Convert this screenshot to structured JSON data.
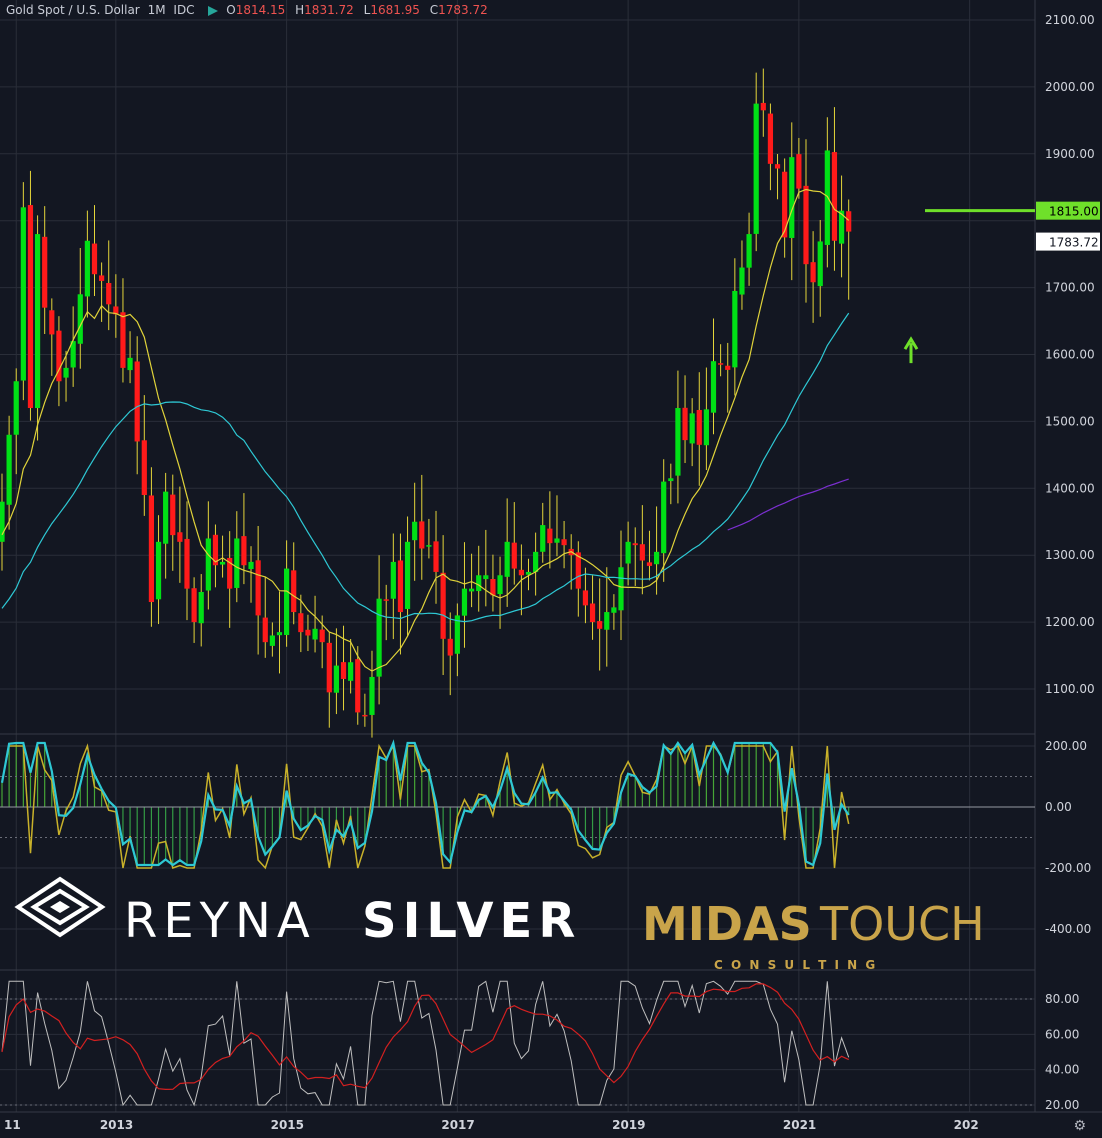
{
  "header": {
    "title": "Gold Spot / U.S. Dollar",
    "interval": "1M",
    "exchange": "IDC",
    "o_label": "O",
    "o": "1814.15",
    "h_label": "H",
    "h": "1831.72",
    "l_label": "L",
    "l": "1681.95",
    "c_label": "C",
    "c": "1783.72"
  },
  "watermark": {
    "left_brand_light": "REYNA",
    "left_brand_bold": "SILVER",
    "right_brand_bold": "MIDAS",
    "right_brand_light": "TOUCH",
    "right_sub": "C O N S U L T I N G"
  },
  "colors": {
    "background": "#131722",
    "up": "#00e016",
    "down": "#ff1a1a",
    "wick": "#e4d53a",
    "ma_short": "#e0d33a",
    "ma_mid": "#2ec8d4",
    "ma_long": "#7b2fd0",
    "marker": "#6fe02a",
    "cci_slow": "#2ec8d4",
    "cci_fast": "#c8b12a",
    "stoch_fast": "#bfbfbf",
    "stoch_slow": "#d32020",
    "gold_brand": "#c9a44a"
  },
  "chart_data": [
    {
      "type": "candlestick",
      "name": "price",
      "x_axis": {
        "unit": "month",
        "range": [
          "2011-09",
          "2022-04"
        ],
        "tick_labels": [
          "11",
          "2013",
          "2015",
          "2017",
          "2019",
          "2021",
          "202"
        ]
      },
      "y_axis": {
        "range": [
          1030,
          2130
        ],
        "ticks": [
          "1100.00",
          "1200.00",
          "1300.00",
          "1400.00",
          "1500.00",
          "1600.00",
          "1700.00",
          "1800.00",
          "1900.00",
          "2000.00",
          "2100.00"
        ]
      },
      "price_labels": {
        "level": "1815.00",
        "last": "1783.72"
      },
      "horizontal_level": 1815,
      "up_arrow_at": 1620,
      "anchors_close": [
        [
          "2011-09",
          1380
        ],
        [
          "2011-10",
          1480
        ],
        [
          "2011-11",
          1560
        ],
        [
          "2011-12",
          1820
        ],
        [
          "2012-01",
          1520
        ],
        [
          "2012-02",
          1780
        ],
        [
          "2012-03",
          1670
        ],
        [
          "2012-04",
          1630
        ],
        [
          "2012-05",
          1560
        ],
        [
          "2012-06",
          1580
        ],
        [
          "2012-07",
          1620
        ],
        [
          "2012-08",
          1690
        ],
        [
          "2012-09",
          1770
        ],
        [
          "2012-10",
          1720
        ],
        [
          "2012-11",
          1710
        ],
        [
          "2012-12",
          1675
        ],
        [
          "2013-01",
          1660
        ],
        [
          "2013-02",
          1580
        ],
        [
          "2013-03",
          1595
        ],
        [
          "2013-04",
          1470
        ],
        [
          "2013-05",
          1390
        ],
        [
          "2013-06",
          1230
        ],
        [
          "2013-07",
          1320
        ],
        [
          "2013-08",
          1395
        ],
        [
          "2013-09",
          1330
        ],
        [
          "2013-10",
          1320
        ],
        [
          "2013-11",
          1250
        ],
        [
          "2013-12",
          1200
        ],
        [
          "2014-01",
          1245
        ],
        [
          "2014-02",
          1325
        ],
        [
          "2014-03",
          1285
        ],
        [
          "2014-04",
          1290
        ],
        [
          "2014-05",
          1250
        ],
        [
          "2014-06",
          1325
        ],
        [
          "2014-07",
          1285
        ],
        [
          "2014-08",
          1290
        ],
        [
          "2014-09",
          1210
        ],
        [
          "2014-10",
          1170
        ],
        [
          "2014-11",
          1180
        ],
        [
          "2014-12",
          1185
        ],
        [
          "2015-01",
          1280
        ],
        [
          "2015-02",
          1215
        ],
        [
          "2015-03",
          1185
        ],
        [
          "2015-04",
          1180
        ],
        [
          "2015-05",
          1190
        ],
        [
          "2015-06",
          1170
        ],
        [
          "2015-07",
          1095
        ],
        [
          "2015-08",
          1135
        ],
        [
          "2015-09",
          1115
        ],
        [
          "2015-10",
          1140
        ],
        [
          "2015-11",
          1065
        ],
        [
          "2015-12",
          1060
        ],
        [
          "2016-01",
          1118
        ],
        [
          "2016-02",
          1235
        ],
        [
          "2016-03",
          1233
        ],
        [
          "2016-04",
          1290
        ],
        [
          "2016-05",
          1215
        ],
        [
          "2016-06",
          1320
        ],
        [
          "2016-07",
          1350
        ],
        [
          "2016-08",
          1310
        ],
        [
          "2016-09",
          1315
        ],
        [
          "2016-10",
          1275
        ],
        [
          "2016-11",
          1175
        ],
        [
          "2016-12",
          1150
        ],
        [
          "2017-01",
          1210
        ],
        [
          "2017-02",
          1250
        ],
        [
          "2017-03",
          1250
        ],
        [
          "2017-04",
          1270
        ],
        [
          "2017-05",
          1270
        ],
        [
          "2017-06",
          1240
        ],
        [
          "2017-07",
          1270
        ],
        [
          "2017-08",
          1320
        ],
        [
          "2017-09",
          1280
        ],
        [
          "2017-10",
          1270
        ],
        [
          "2017-11",
          1275
        ],
        [
          "2017-12",
          1305
        ],
        [
          "2018-01",
          1345
        ],
        [
          "2018-02",
          1318
        ],
        [
          "2018-03",
          1325
        ],
        [
          "2018-04",
          1315
        ],
        [
          "2018-05",
          1300
        ],
        [
          "2018-06",
          1250
        ],
        [
          "2018-07",
          1225
        ],
        [
          "2018-08",
          1200
        ],
        [
          "2018-09",
          1190
        ],
        [
          "2018-10",
          1215
        ],
        [
          "2018-11",
          1222
        ],
        [
          "2018-12",
          1282
        ],
        [
          "2019-01",
          1320
        ],
        [
          "2019-02",
          1315
        ],
        [
          "2019-03",
          1292
        ],
        [
          "2019-04",
          1284
        ],
        [
          "2019-05",
          1305
        ],
        [
          "2019-06",
          1410
        ],
        [
          "2019-07",
          1415
        ],
        [
          "2019-08",
          1520
        ],
        [
          "2019-09",
          1472
        ],
        [
          "2019-10",
          1512
        ],
        [
          "2019-11",
          1465
        ],
        [
          "2019-12",
          1518
        ],
        [
          "2020-01",
          1590
        ],
        [
          "2020-02",
          1585
        ],
        [
          "2020-03",
          1577
        ],
        [
          "2020-04",
          1695
        ],
        [
          "2020-05",
          1730
        ],
        [
          "2020-06",
          1780
        ],
        [
          "2020-07",
          1975
        ],
        [
          "2020-08",
          1965
        ],
        [
          "2020-09",
          1885
        ],
        [
          "2020-10",
          1878
        ],
        [
          "2020-11",
          1775
        ],
        [
          "2020-12",
          1895
        ],
        [
          "2021-01",
          1848
        ],
        [
          "2021-02",
          1735
        ],
        [
          "2021-03",
          1708
        ],
        [
          "2021-04",
          1769
        ],
        [
          "2021-05",
          1905
        ],
        [
          "2021-06",
          1770
        ],
        [
          "2021-07",
          1815
        ],
        [
          "2021-08",
          1784
        ]
      ]
    },
    {
      "type": "line",
      "name": "cci",
      "y_axis": {
        "range": [
          -420,
          220
        ],
        "ticks": [
          "200.00",
          "0.00",
          "-200.00",
          "-400.00"
        ],
        "bands": [
          100,
          -100
        ]
      }
    },
    {
      "type": "line",
      "name": "stochastic",
      "y_axis": {
        "range": [
          18,
          100
        ],
        "ticks": [
          "80.00",
          "60.00",
          "40.00",
          "20.00"
        ],
        "bands": [
          80,
          20
        ]
      }
    }
  ]
}
